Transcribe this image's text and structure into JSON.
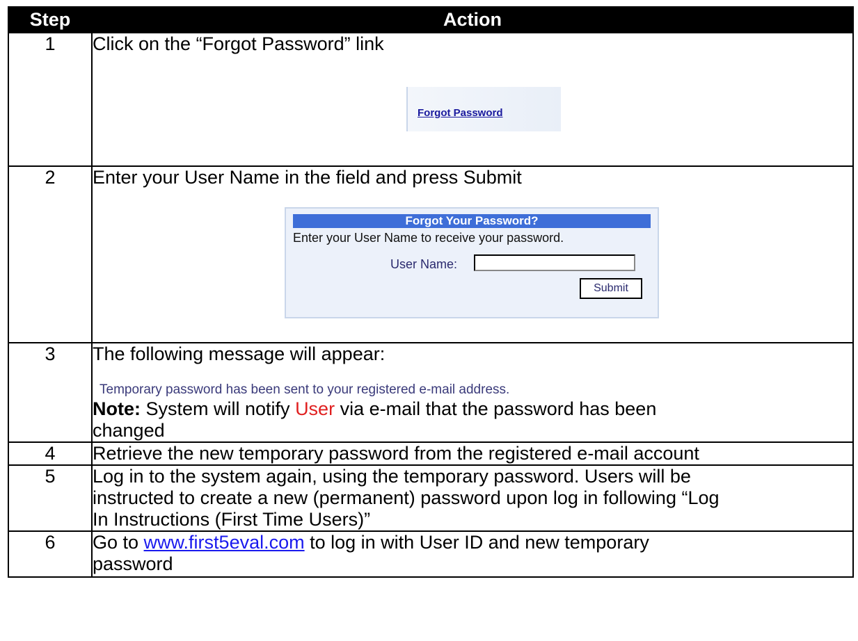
{
  "table": {
    "headers": {
      "step": "Step",
      "action": "Action"
    },
    "rows": [
      {
        "step": "1",
        "text": "Click on the “Forgot Password” link"
      },
      {
        "step": "2",
        "text": "Enter your User Name in the field and press Submit"
      },
      {
        "step": "3",
        "text": "The following message will appear:"
      },
      {
        "step": "4",
        "text": "Retrieve the new temporary password from the registered e-mail account"
      },
      {
        "step": "5",
        "line1": "Log in to the system again, using the temporary password.  Users will be",
        "line2": "instructed to create a new (permanent) password upon log in following “Log",
        "line3": "In Instructions (First Time Users)”"
      },
      {
        "step": "6",
        "link": "www.first5eval.com",
        "line1_rest": " to log in with User ID and new temporary",
        "line2": "password",
        "prefix": "Go to "
      }
    ]
  },
  "forgot_link": {
    "label": "Forgot Password"
  },
  "forgot_panel": {
    "title": "Forgot Your Password?",
    "instruction": "Enter your User Name to receive your password.",
    "user_label": "User Name:",
    "user_value": "",
    "submit_label": "Submit"
  },
  "step3": {
    "message": "Temporary password has been sent to your registered e-mail address.",
    "note_label": "Note:",
    "note_pre": " System will notify ",
    "note_user": "User",
    "note_post": " via e-mail that the password has been",
    "note_line2": "changed"
  },
  "colors": {
    "header_bg": "#000000",
    "panel_head": "#3e6ed8",
    "link": "#1a1aee",
    "highlight": "#e02020"
  }
}
